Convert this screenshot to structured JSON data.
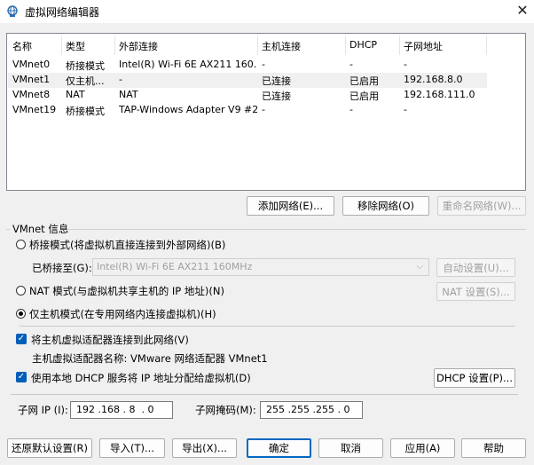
{
  "window": {
    "title": "虚拟网络编辑器",
    "close_symbol": "✕"
  },
  "table": {
    "columns": [
      "名称",
      "类型",
      "外部连接",
      "主机连接",
      "DHCP",
      "子网地址"
    ],
    "rows": [
      [
        "VMnet0",
        "桥接模式",
        "Intel(R) Wi-Fi 6E AX211 160...",
        "-",
        "-",
        "-"
      ],
      [
        "VMnet1",
        "仅主机...",
        "-",
        "已连接",
        "已启用",
        "192.168.8.0"
      ],
      [
        "VMnet8",
        "NAT",
        "NAT",
        "已连接",
        "已启用",
        "192.168.111.0"
      ],
      [
        "VMnet19",
        "桥接模式",
        "TAP-Windows Adapter V9 #2",
        "-",
        "-",
        "-"
      ]
    ]
  },
  "list_buttons": {
    "add": "添加网络(E)...",
    "remove": "移除网络(O)",
    "rename": "重命名网络(W)..."
  },
  "vmnet_info": {
    "group_title": "VMnet 信息",
    "bridged_radio": "桥接模式(将虚拟机直接连接到外部网络)(B)",
    "bridged_to_label": "已桥接至(G):",
    "bridged_to_value": "Intel(R) Wi-Fi 6E AX211 160MHz",
    "auto_settings": "自动设置(U)...",
    "nat_radio": "NAT 模式(与虚拟机共享主机的 IP 地址)(N)",
    "nat_settings": "NAT 设置(S)...",
    "hostonly_radio": "仅主机模式(在专用网络内连接虚拟机)(H)",
    "connect_adapter_check": "将主机虚拟适配器连接到此网络(V)",
    "adapter_name_text": "主机虚拟适配器名称: VMware 网络适配器 VMnet1",
    "dhcp_check": "使用本地 DHCP 服务将 IP 地址分配给虚拟机(D)",
    "dhcp_settings": "DHCP 设置(P)...",
    "subnet_ip_label": "子网 IP (I):",
    "subnet_ip_value": "192 .168 . 8  . 0",
    "subnet_mask_label": "子网掩码(M):",
    "subnet_mask_value": "255 .255 .255 . 0",
    "selected_mode": "host-only",
    "connect_adapter_checked": true,
    "dhcp_checked": true
  },
  "footer_buttons": {
    "restore": "还原默认设置(R)",
    "import": "导入(T)...",
    "export": "导出(X)...",
    "ok": "确定",
    "cancel": "取消",
    "apply": "应用(A)",
    "help": "帮助"
  },
  "colors": {
    "accent": "#005fb8",
    "selection_row": "#f0f0f0",
    "window_bg": "#f0f0f0"
  },
  "icons": {
    "title": "network-globe-icon",
    "check": "checkmark-icon",
    "combo": "chevron-down-icon"
  }
}
